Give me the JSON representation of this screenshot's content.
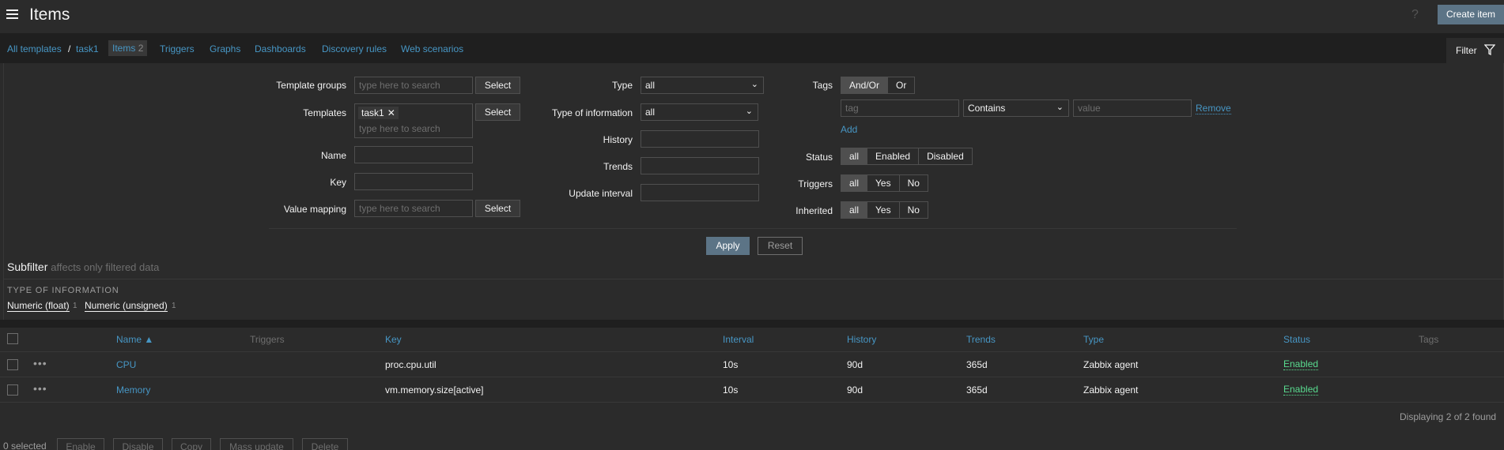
{
  "header": {
    "title": "Items",
    "help": "?",
    "create_button": "Create item"
  },
  "nav": {
    "all_templates": "All templates",
    "sep": "/",
    "template": "task1",
    "items_label": "Items",
    "items_count": "2",
    "triggers": "Triggers",
    "graphs": "Graphs",
    "dashboards": "Dashboards",
    "discovery": "Discovery rules",
    "web": "Web scenarios",
    "filter_tab": "Filter"
  },
  "filter": {
    "template_groups_label": "Template groups",
    "template_groups_placeholder": "type here to search",
    "templates_label": "Templates",
    "templates_chip": "task1",
    "templates_placeholder": "type here to search",
    "name_label": "Name",
    "key_label": "Key",
    "value_mapping_label": "Value mapping",
    "value_mapping_placeholder": "type here to search",
    "select_label": "Select",
    "type_label": "Type",
    "type_value": "all",
    "typeinfo_label": "Type of information",
    "typeinfo_value": "all",
    "history_label": "History",
    "trends_label": "Trends",
    "update_label": "Update interval",
    "tags_label": "Tags",
    "tags_andor": "And/Or",
    "tags_or": "Or",
    "tag_placeholder": "tag",
    "tag_operator": "Contains",
    "value_placeholder": "value",
    "remove": "Remove",
    "add": "Add",
    "status_label": "Status",
    "status_all": "all",
    "status_enabled": "Enabled",
    "status_disabled": "Disabled",
    "triggers_label": "Triggers",
    "inherited_label": "Inherited",
    "opt_all": "all",
    "opt_yes": "Yes",
    "opt_no": "No",
    "apply": "Apply",
    "reset": "Reset"
  },
  "subfilter": {
    "title": "Subfilter",
    "note": "affects only filtered data",
    "section": "TYPE OF INFORMATION",
    "items": [
      {
        "label": "Numeric (float)",
        "count": "1"
      },
      {
        "label": "Numeric (unsigned)",
        "count": "1"
      }
    ]
  },
  "table": {
    "headers": {
      "name": "Name ▲",
      "triggers": "Triggers",
      "key": "Key",
      "interval": "Interval",
      "history": "History",
      "trends": "Trends",
      "type": "Type",
      "status": "Status",
      "tags": "Tags"
    },
    "rows": [
      {
        "name": "CPU",
        "key": "proc.cpu.util",
        "interval": "10s",
        "history": "90d",
        "trends": "365d",
        "type": "Zabbix agent",
        "status": "Enabled"
      },
      {
        "name": "Memory",
        "key": "vm.memory.size[active]",
        "interval": "10s",
        "history": "90d",
        "trends": "365d",
        "type": "Zabbix agent",
        "status": "Enabled"
      }
    ],
    "displaying": "Displaying 2 of 2 found"
  },
  "footer": {
    "selected": "0 selected",
    "enable": "Enable",
    "disable": "Disable",
    "copy": "Copy",
    "mass_update": "Mass update",
    "delete": "Delete"
  },
  "colors": {
    "accent": "#4796c4",
    "enabled": "#59db8f",
    "primary_button": "#5c7486"
  }
}
